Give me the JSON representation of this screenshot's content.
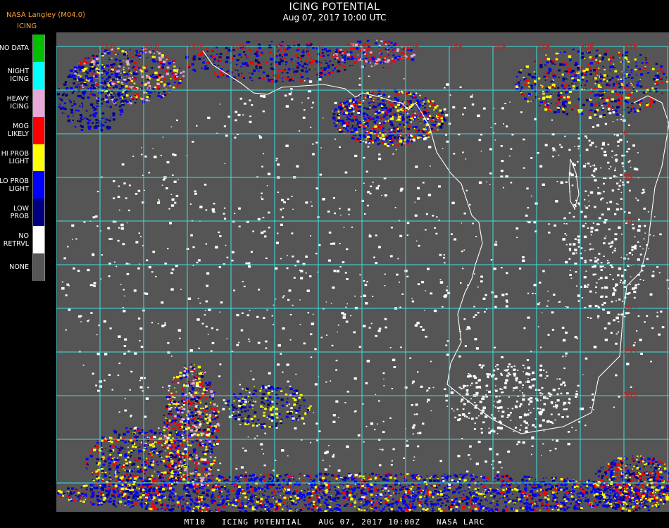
{
  "header": {
    "title": "ICING POTENTIAL",
    "datetime": "Aug 07, 2017 10:00 UTC",
    "source": "NASA Langley (M04.0)",
    "product": "ICING"
  },
  "legend": [
    {
      "label": "NO DATA",
      "color": "#00c000"
    },
    {
      "label": "NIGHT\nICING",
      "color": "#00ffff"
    },
    {
      "label": "HEAVY\nICING",
      "color": "#e8a8d8"
    },
    {
      "label": "MOG\nLIKELY",
      "color": "#ff0000"
    },
    {
      "label": "HI PROB\nLIGHT",
      "color": "#ffff00"
    },
    {
      "label": "LO PROB\nLIGHT",
      "color": "#0000ff"
    },
    {
      "label": "LOW\nPROB",
      "color": "#000080"
    },
    {
      "label": "NO\nRETRVL",
      "color": "#ffffff"
    },
    {
      "label": "NONE",
      "color": "#555555"
    }
  ],
  "map": {
    "background": "#555555",
    "grid_color": "#40e0e0",
    "coast_color": "#ffffff",
    "grid_labels_top": [
      "25W",
      "20W",
      "15W",
      "10W",
      "5W",
      "0",
      "5E",
      "10E",
      "15E",
      "20E",
      "25E",
      "30E",
      "35E",
      "40E"
    ],
    "grid_labels_right": [
      "5N",
      "0",
      "5S",
      "10S",
      "15S",
      "20S",
      "25S",
      "30S"
    ]
  },
  "footer": "MT10   ICING POTENTIAL   AUG 07, 2017 10:00Z   NASA LARC"
}
